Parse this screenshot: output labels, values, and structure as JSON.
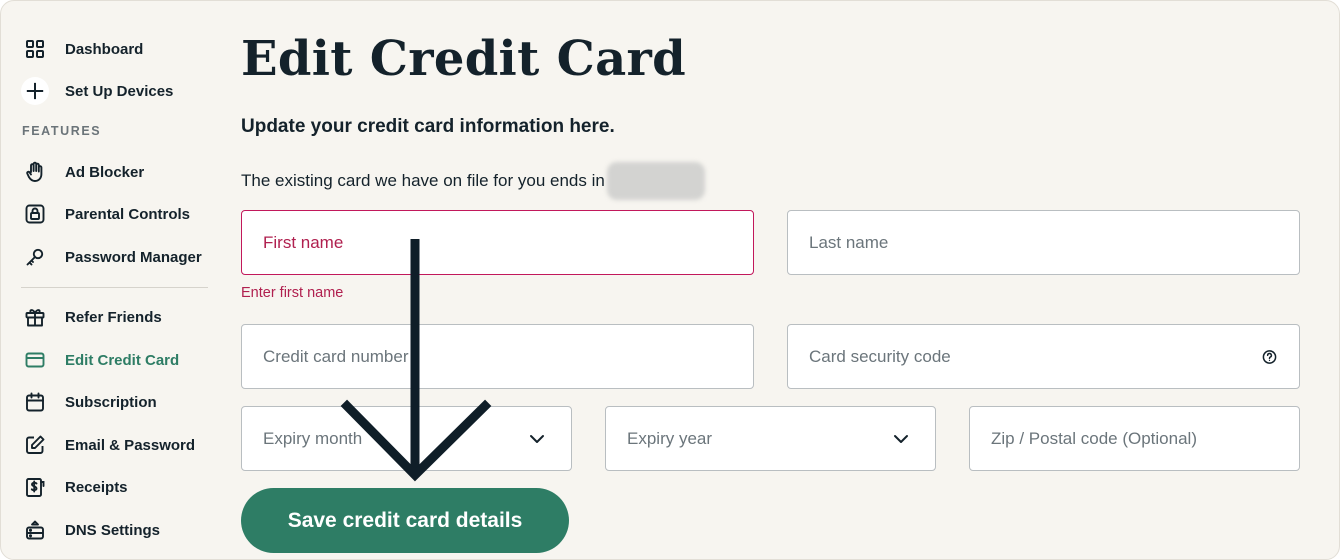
{
  "sidebar": {
    "items": [
      {
        "label": "Dashboard",
        "icon": "grid-icon"
      },
      {
        "label": "Set Up Devices",
        "icon": "plus-icon"
      }
    ],
    "features_label": "FEATURES",
    "features": [
      {
        "label": "Ad Blocker",
        "icon": "hand-icon"
      },
      {
        "label": "Parental Controls",
        "icon": "lock-icon"
      },
      {
        "label": "Password Manager",
        "icon": "key-icon"
      }
    ],
    "account": [
      {
        "label": "Refer Friends",
        "icon": "gift-icon"
      },
      {
        "label": "Edit Credit Card",
        "icon": "credit-card-icon",
        "active": true
      },
      {
        "label": "Subscription",
        "icon": "calendar-icon"
      },
      {
        "label": "Email & Password",
        "icon": "edit-icon"
      },
      {
        "label": "Receipts",
        "icon": "receipt-icon"
      },
      {
        "label": "DNS Settings",
        "icon": "dns-icon"
      }
    ]
  },
  "main": {
    "title": "Edit Credit Card",
    "subtitle": "Update your credit card information here.",
    "existing_text": "The existing card we have on file for you ends in",
    "form": {
      "first_name_placeholder": "First name",
      "first_name_error": "Enter first name",
      "last_name_placeholder": "Last name",
      "card_number_placeholder": "Credit card number",
      "security_code_placeholder": "Card security code",
      "expiry_month_placeholder": "Expiry month",
      "expiry_year_placeholder": "Expiry year",
      "zip_placeholder": "Zip / Postal code (Optional)",
      "save_label": "Save credit card details"
    }
  },
  "colors": {
    "accent": "#2e7d65",
    "error": "#b0204f",
    "background": "#f7f5f0",
    "text": "#14222b"
  }
}
